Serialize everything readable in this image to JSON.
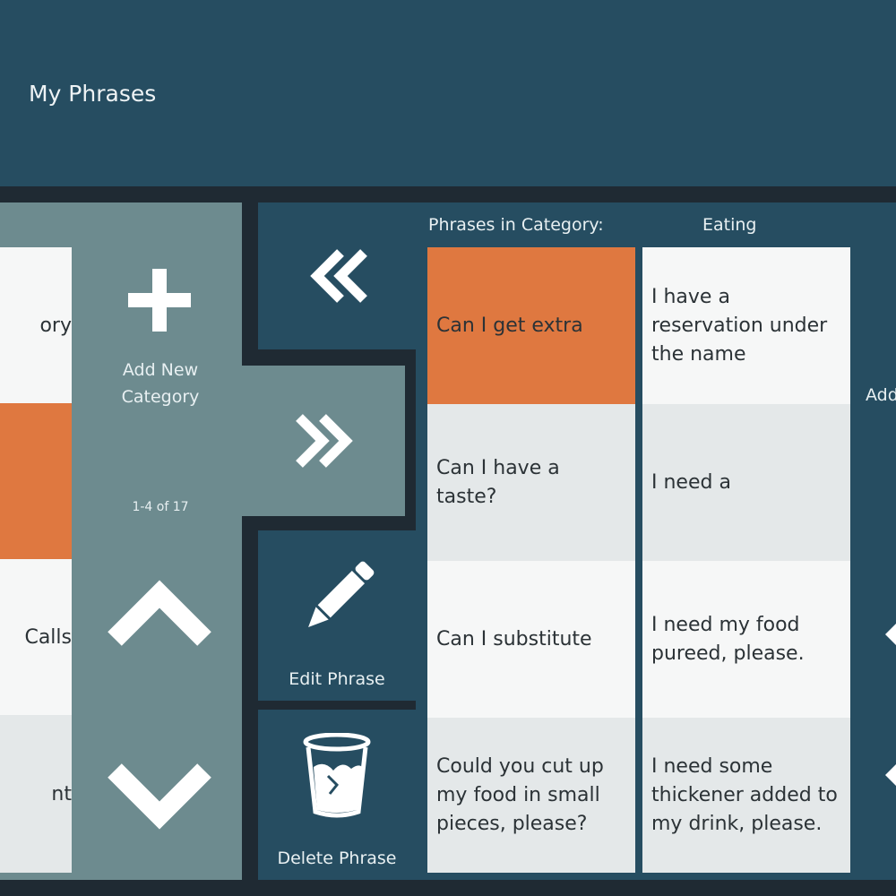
{
  "header": {
    "title": "My Phrases"
  },
  "categories": {
    "items": [
      {
        "label": "ory"
      },
      {
        "label": ""
      },
      {
        "label": "Calls"
      },
      {
        "label": "nt"
      }
    ],
    "add_label_line1": "Add New",
    "add_label_line2": "Category",
    "pagination": "1-4 of 17"
  },
  "phrases": {
    "heading": "Phrases in Category:",
    "category": "Eating",
    "items": [
      {
        "text": "Can I get extra"
      },
      {
        "text": "Can I have a taste?"
      },
      {
        "text": "Can I substitute"
      },
      {
        "text": "Could you cut up my food in small pieces, please?"
      },
      {
        "text": "I have a reservation under the name"
      },
      {
        "text": "I need a"
      },
      {
        "text": "I need my food pureed, please."
      },
      {
        "text": "I need some thickener added to my drink, please."
      }
    ]
  },
  "actions": {
    "edit_label": "Edit Phrase",
    "delete_label": "Delete Phrase",
    "add_phrase_partial": "Add"
  },
  "icons": {
    "add": "plus-icon",
    "prev": "double-chevron-left-icon",
    "next": "double-chevron-right-icon",
    "up": "chevron-up-icon",
    "down": "chevron-down-icon",
    "edit": "pencil-icon",
    "delete": "trash-cup-icon"
  },
  "colors": {
    "header": "#264d61",
    "panel": "#6d8b8f",
    "accent": "#df7840",
    "cell_light": "#e4e8e9",
    "cell_white": "#f6f7f7"
  }
}
